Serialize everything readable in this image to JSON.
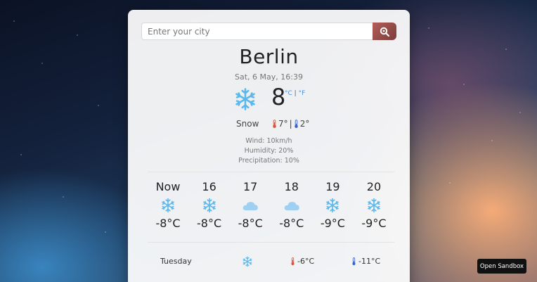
{
  "search": {
    "placeholder": "Enter your city"
  },
  "current": {
    "city": "Berlin",
    "date": "Sat, 6 May, 16:39",
    "temperature": "8",
    "unit_c": "°C",
    "unit_sep": " | ",
    "unit_f": "°F",
    "condition": "Snow",
    "high": "7°",
    "low": "2°",
    "hilo_sep": "|",
    "icon": "snowflake-icon",
    "wind": "Wind: 10km/h",
    "humidity": "Humidity: 20%",
    "precipitation": "Precipitation: 10%"
  },
  "hourly": [
    {
      "label": "Now",
      "icon": "snowflake-icon",
      "temp": "-8°C"
    },
    {
      "label": "16",
      "icon": "snowflake-icon",
      "temp": "-8°C"
    },
    {
      "label": "17",
      "icon": "cloud-icon",
      "temp": "-8°C"
    },
    {
      "label": "18",
      "icon": "cloud-icon",
      "temp": "-8°C"
    },
    {
      "label": "19",
      "icon": "snowflake-icon",
      "temp": "-9°C"
    },
    {
      "label": "20",
      "icon": "snowflake-icon",
      "temp": "-9°C"
    }
  ],
  "daily": [
    {
      "day": "Tuesday",
      "icon": "snowflake-icon",
      "max": "-6°C",
      "min": "-11°C"
    }
  ],
  "sandbox": {
    "label": "Open Sandbox"
  },
  "colors": {
    "snow": "#5bb8ec",
    "cloud": "#8fc8ee",
    "hot": "#e0523c",
    "cold": "#3b63c9",
    "search_button": "#9a4a46"
  }
}
